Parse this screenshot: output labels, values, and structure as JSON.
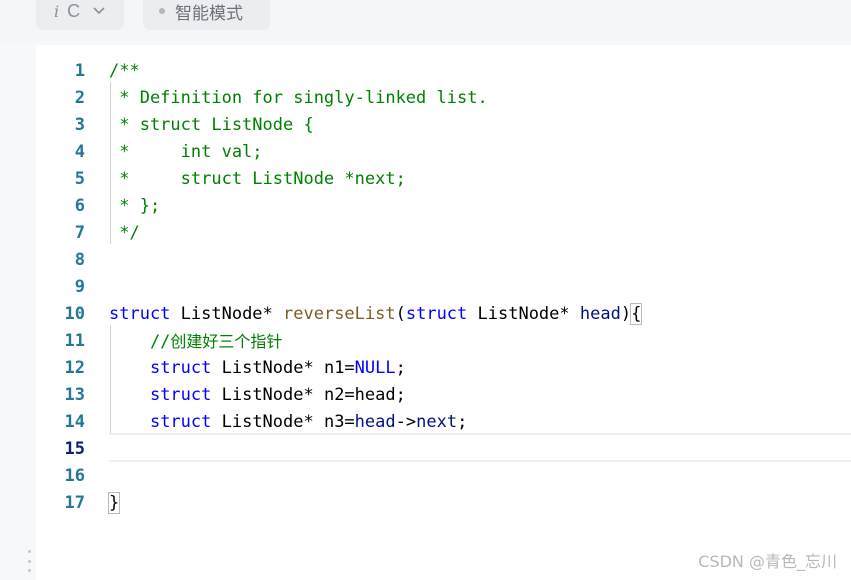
{
  "toolbar": {
    "language_icon": "i",
    "language": "C",
    "mode": "智能模式"
  },
  "editor": {
    "active_line": 15,
    "lines": [
      {
        "n": "1",
        "tokens": [
          {
            "t": "/**",
            "c": "comment"
          }
        ]
      },
      {
        "n": "2",
        "tokens": [
          {
            "t": " * Definition for singly-linked list.",
            "c": "comment"
          }
        ]
      },
      {
        "n": "3",
        "tokens": [
          {
            "t": " * struct ListNode {",
            "c": "comment"
          }
        ]
      },
      {
        "n": "4",
        "tokens": [
          {
            "t": " *     int val;",
            "c": "comment"
          }
        ]
      },
      {
        "n": "5",
        "tokens": [
          {
            "t": " *     struct ListNode *next;",
            "c": "comment"
          }
        ]
      },
      {
        "n": "6",
        "tokens": [
          {
            "t": " * };",
            "c": "comment"
          }
        ]
      },
      {
        "n": "7",
        "tokens": [
          {
            "t": " */",
            "c": "comment"
          }
        ]
      },
      {
        "n": "8",
        "tokens": []
      },
      {
        "n": "9",
        "tokens": []
      },
      {
        "n": "10",
        "tokens": [
          {
            "t": "struct",
            "c": "kw"
          },
          {
            "t": " ListNode* ",
            "c": "plain"
          },
          {
            "t": "reverseList",
            "c": "fn"
          },
          {
            "t": "(",
            "c": "plain"
          },
          {
            "t": "struct",
            "c": "kw"
          },
          {
            "t": " ListNode* ",
            "c": "plain"
          },
          {
            "t": "head",
            "c": "param"
          },
          {
            "t": ")",
            "c": "plain"
          },
          {
            "t": "{",
            "c": "bracket"
          }
        ]
      },
      {
        "n": "11",
        "tokens": [
          {
            "t": "    //",
            "c": "comment"
          },
          {
            "t": "创建好三个指针",
            "c": "cn"
          }
        ]
      },
      {
        "n": "12",
        "tokens": [
          {
            "t": "    ",
            "c": "plain"
          },
          {
            "t": "struct",
            "c": "kw"
          },
          {
            "t": " ListNode* n1=",
            "c": "plain"
          },
          {
            "t": "NULL",
            "c": "const"
          },
          {
            "t": ";",
            "c": "plain"
          }
        ]
      },
      {
        "n": "13",
        "tokens": [
          {
            "t": "    ",
            "c": "plain"
          },
          {
            "t": "struct",
            "c": "kw"
          },
          {
            "t": " ListNode* n2=head;",
            "c": "plain"
          }
        ]
      },
      {
        "n": "14",
        "tokens": [
          {
            "t": "    ",
            "c": "plain"
          },
          {
            "t": "struct",
            "c": "kw"
          },
          {
            "t": " ListNode* n3=",
            "c": "plain"
          },
          {
            "t": "head",
            "c": "param"
          },
          {
            "t": "->",
            "c": "plain"
          },
          {
            "t": "next",
            "c": "param"
          },
          {
            "t": ";",
            "c": "plain"
          }
        ]
      },
      {
        "n": "15",
        "tokens": []
      },
      {
        "n": "16",
        "tokens": []
      },
      {
        "n": "17",
        "tokens": [
          {
            "t": "}",
            "c": "bracket"
          }
        ]
      }
    ]
  },
  "watermark": "CSDN @青色_忘川",
  "colors": {
    "comment": "#008000",
    "keyword": "#0000ff",
    "function": "#795e26",
    "parameter": "#001080",
    "line_number": "#237893"
  }
}
